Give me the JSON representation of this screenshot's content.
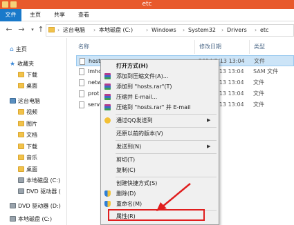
{
  "window": {
    "title": "etc"
  },
  "ribbon": {
    "tabs": [
      "文件",
      "主页",
      "共享",
      "查看"
    ]
  },
  "address": {
    "crumbs": [
      "这台电脑",
      "本地磁盘 (C:)",
      "Windows",
      "System32",
      "Drivers",
      "etc"
    ]
  },
  "nav": {
    "items": [
      {
        "label": "主页",
        "icon": "home-icon"
      },
      {
        "label": "收藏夹",
        "icon": "star-icon"
      },
      {
        "label": "下载",
        "icon": "folder-icon"
      },
      {
        "label": "桌面",
        "icon": "folder-icon"
      },
      {
        "label": "这台电脑",
        "icon": "pc-icon"
      },
      {
        "label": "视频",
        "icon": "folder-icon"
      },
      {
        "label": "图片",
        "icon": "folder-icon"
      },
      {
        "label": "文档",
        "icon": "folder-icon"
      },
      {
        "label": "下载",
        "icon": "folder-icon"
      },
      {
        "label": "音乐",
        "icon": "folder-icon"
      },
      {
        "label": "桌面",
        "icon": "folder-icon"
      },
      {
        "label": "本地磁盘 (C:)",
        "icon": "drive-icon"
      },
      {
        "label": "DVD 驱动器 (",
        "icon": "drive-icon"
      },
      {
        "label": "DVD 驱动器 (D:)",
        "icon": "drive-icon"
      },
      {
        "label": "本地磁盘 (C:)",
        "icon": "drive-icon"
      }
    ]
  },
  "columns": {
    "name": "名称",
    "date": "修改日期",
    "type": "类型"
  },
  "files": [
    {
      "name": "hosts",
      "date": "2014/9/13 13:04",
      "type": "文件"
    },
    {
      "name": "lmhc",
      "date": "2014/9/13 13:04",
      "type": "SAM 文件"
    },
    {
      "name": "netw",
      "date": "2014/9/13 13:04",
      "type": "文件"
    },
    {
      "name": "prot",
      "date": "2014/9/13 13:04",
      "type": "文件"
    },
    {
      "name": "servi",
      "date": "2014/9/13 13:04",
      "type": "文件"
    }
  ],
  "context_menu": {
    "items": [
      {
        "label": "打开方式(H)",
        "icon": ""
      },
      {
        "label": "添加到压缩文件(A)...",
        "icon": "rar-icon"
      },
      {
        "label": "添加到 \"hosts.rar\"(T)",
        "icon": "rar-icon"
      },
      {
        "label": "压缩并 E-mail...",
        "icon": "rar-icon"
      },
      {
        "label": "压缩到 \"hosts.rar\" 并 E-mail",
        "icon": "rar-icon"
      },
      {
        "label": "通过QQ发送到",
        "icon": "qq-icon"
      },
      {
        "label": "还原以前的版本(V)",
        "icon": ""
      },
      {
        "label": "发送到(N)",
        "icon": ""
      },
      {
        "label": "剪切(T)",
        "icon": ""
      },
      {
        "label": "复制(C)",
        "icon": ""
      },
      {
        "label": "创建快捷方式(S)",
        "icon": ""
      },
      {
        "label": "删除(D)",
        "icon": "shield-icon"
      },
      {
        "label": "重命名(M)",
        "icon": "shield-icon"
      },
      {
        "label": "属性(R)",
        "icon": ""
      }
    ]
  },
  "colors": {
    "titlebar": "#e85a2c",
    "file_tab": "#1979ca",
    "selection": "#cce4f7",
    "highlight": "#e01e1e"
  }
}
